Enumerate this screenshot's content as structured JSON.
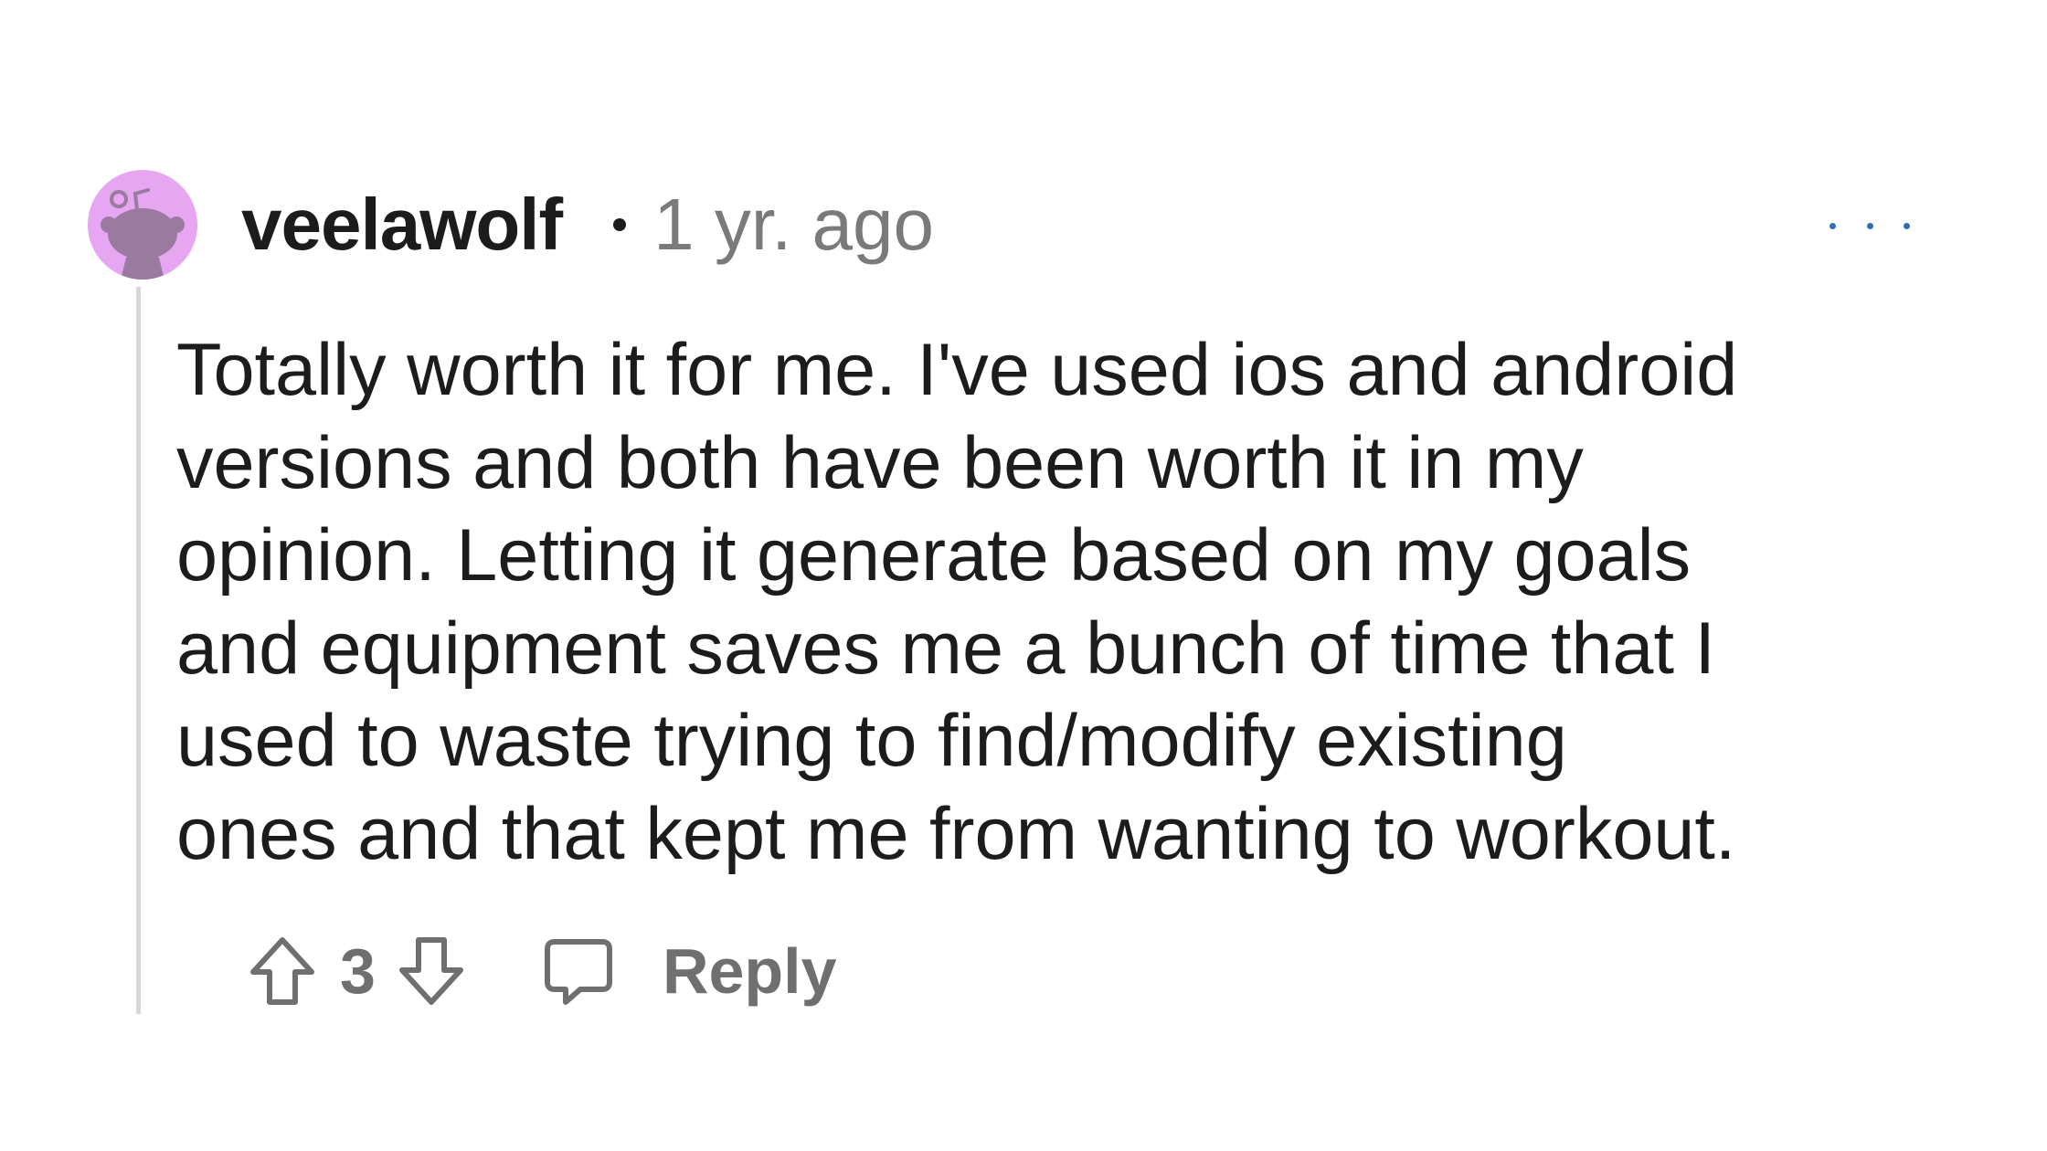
{
  "comment": {
    "author": "veelawolf",
    "timestamp": "1 yr. ago",
    "body_lines": [
      "Totally worth it for me. I've used ios and android",
      "versions and both have been worth it in my",
      "opinion. Letting it generate based on my goals",
      "and equipment saves me a bunch of time that I",
      "used to waste trying to find/modify existing",
      "ones and that kept me from wanting to workout."
    ],
    "vote_count": "3",
    "reply_label": "Reply"
  },
  "icons": {
    "avatar": "snoo-avatar-icon",
    "more": "more-options-icon",
    "upvote": "upvote-arrow-icon",
    "downvote": "downvote-arrow-icon",
    "reply": "speech-bubble-icon"
  },
  "colors": {
    "avatar_background": "#e6a6f2",
    "avatar_figure": "#9a7b9f",
    "username": "#1c1c1c",
    "timestamp": "#7a7a7a",
    "more_dots": "#2f6fb3",
    "action_gray": "#6f6f6f",
    "thread_line": "#d8d8d8"
  }
}
